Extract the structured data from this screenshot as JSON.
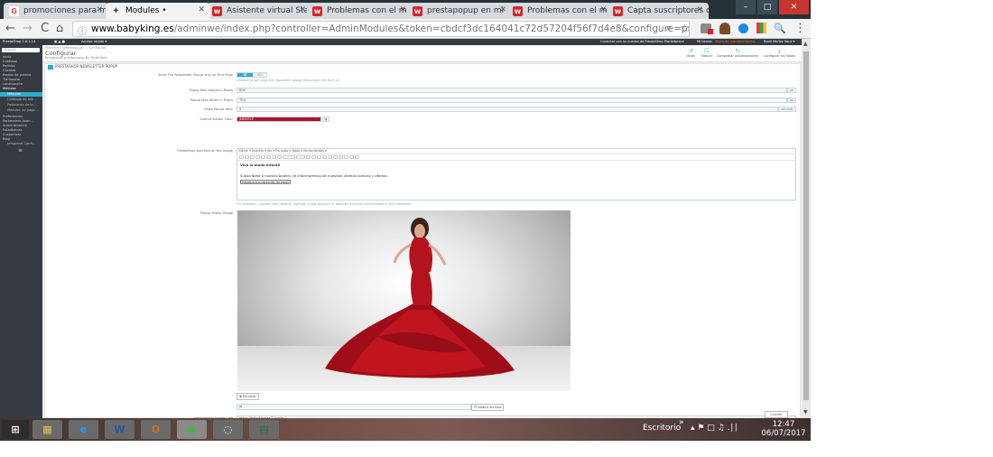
{
  "browser": {
    "tabs": [
      {
        "label": "promociones para m",
        "icon": "G",
        "icon_color": "#ea4335"
      },
      {
        "label": "Modules •",
        "icon": "✦",
        "icon_color": "#555555"
      },
      {
        "label": "Asistente virtual Sta",
        "icon": "w",
        "icon_color": "#d8232a"
      },
      {
        "label": "Problemas con el m",
        "icon": "w",
        "icon_color": "#d8232a"
      },
      {
        "label": "prestapopup en mi",
        "icon": "w",
        "icon_color": "#d8232a"
      },
      {
        "label": "Problemas con el m",
        "icon": "w",
        "icon_color": "#d8232a"
      },
      {
        "label": "Capta suscriptores o",
        "icon": "w",
        "icon_color": "#d8232a"
      }
    ],
    "url_host": "www.babyking.es",
    "url_path": "/adminwe/index.php?controller=AdminModules&token=cbdcf3dc164041c72d57204f56f7d4e8&configure=prestapopup&tab_module=fron",
    "buttons": {
      "back": "←",
      "forward": "→",
      "reload": "C",
      "home": "⌂",
      "zoom": "⌕",
      "star": "☆",
      "menu": "⋮",
      "minimize": "–",
      "maximize": "□",
      "close": "✕"
    }
  },
  "ps_header": {
    "left": "PrestaShop 1.6.1.14",
    "quick_access": "Acceso rápido ▾",
    "right_links": [
      "Conectar con su cuenta de PrestaShop Marketplace",
      "Mi tienda",
      "Modo de mantenimiento",
      "Rodil Muñoz Sanz ▾"
    ]
  },
  "sidebar": {
    "search_placeholder": "Buscar",
    "items": [
      {
        "label": "Inicio",
        "type": "main"
      },
      {
        "label": "Catálogo",
        "type": "main"
      },
      {
        "label": "Pedidos",
        "type": "main"
      },
      {
        "label": "Clientes",
        "type": "main"
      },
      {
        "label": "Reglas de precios",
        "type": "main"
      },
      {
        "label": "Transporte",
        "type": "main"
      },
      {
        "label": "Localización",
        "type": "main"
      },
      {
        "label": "Módulos",
        "type": "active"
      },
      {
        "label": "Módulos",
        "type": "hl"
      },
      {
        "label": "Catálogo de mó...",
        "type": "sub"
      },
      {
        "label": "Posiciones de lo...",
        "type": "sub"
      },
      {
        "label": "Módulos de pago ...",
        "type": "sub"
      },
      {
        "label": "Preferencias",
        "type": "main"
      },
      {
        "label": "Parámetros Avan...",
        "type": "main"
      },
      {
        "label": "Administración",
        "type": "main"
      },
      {
        "label": "Estadísticas",
        "type": "main"
      },
      {
        "label": "Customizar",
        "type": "main"
      },
      {
        "label": "Blog",
        "type": "main"
      },
      {
        "label": "Infogrand Confi...",
        "type": "sub"
      }
    ]
  },
  "page": {
    "breadcrumb": "Módulos  /  prestapopup  /  ✓  Configurar",
    "title": "Configurar",
    "subtitle": "Prestashop prestapopup By MyAddons",
    "toolbar": [
      {
        "icon": "↺",
        "label": "Atrás"
      },
      {
        "icon": "☐",
        "label": "Traducir"
      },
      {
        "icon": "↻",
        "label": "Comprobar actualizaciones"
      },
      {
        "icon": "⤓",
        "label": "Configurar los hooks"
      }
    ]
  },
  "form": {
    "heading": "PRESTASHOP NEWSLETTER POPUP",
    "fields": {
      "show_first": {
        "label": "Show The Newsletter Popup only on First Page",
        "on": "SÍ",
        "off": "NO",
        "hint": "(Default) It will show the newsletter popup throughout the store :D"
      },
      "max_height": {
        "label": "Popup Max Height in Pixels",
        "value": "600",
        "unit": "px"
      },
      "max_width": {
        "label": "Popup Max Width in Pixels",
        "value": "700",
        "unit": "px"
      },
      "show_after": {
        "label": "Show Popup After",
        "value": "5",
        "unit": "seconds"
      },
      "button_color": {
        "label": "Submit Button Color",
        "value": "#B30F2E",
        "swatch": "#b30f2e"
      },
      "text_image": {
        "label": "PrestaShop Add text on the Image",
        "menu": "Editar ▾   Insertar ▾   Ver ▾   Formato ▾   Tabla ▾   Herramientas ▾",
        "title": "Viva la moda infantil",
        "body": "Subscríbete a nuestro boletín, te informaremos de nuestras últimas noticias y ofertas.",
        "button": "Introduzca su dirección de email",
        "hint": "For example... explain your mission, highlight a new product, or describe a recent event related to the newsletter."
      },
      "popup_image": {
        "label": "Popup Popup Image",
        "delete": "✖ Eliminar",
        "add_file": "❐ Añadir archivo"
      },
      "image_link": {
        "label": "prestapopup Image Link",
        "value": "https://babyking.es/1-inicio"
      }
    },
    "save": "Guardar"
  },
  "taskbar": {
    "apps": [
      {
        "glyph": "▦",
        "color": "#e8c45a"
      },
      {
        "glyph": "e",
        "color": "#1ea1f1"
      },
      {
        "glyph": "W",
        "color": "#2b579a"
      },
      {
        "glyph": "O",
        "color": "#dc6b26"
      },
      {
        "glyph": "●",
        "color": "#4caf50"
      },
      {
        "glyph": "◌",
        "color": "#ffffff"
      },
      {
        "glyph": "▤",
        "color": "#2d6c3f"
      }
    ],
    "desktop_label": "Escritorio",
    "chevron": "»",
    "tray": "▴  ⚑  □  ♫  .∣∣",
    "time": "12:47",
    "date": "06/07/2017"
  }
}
